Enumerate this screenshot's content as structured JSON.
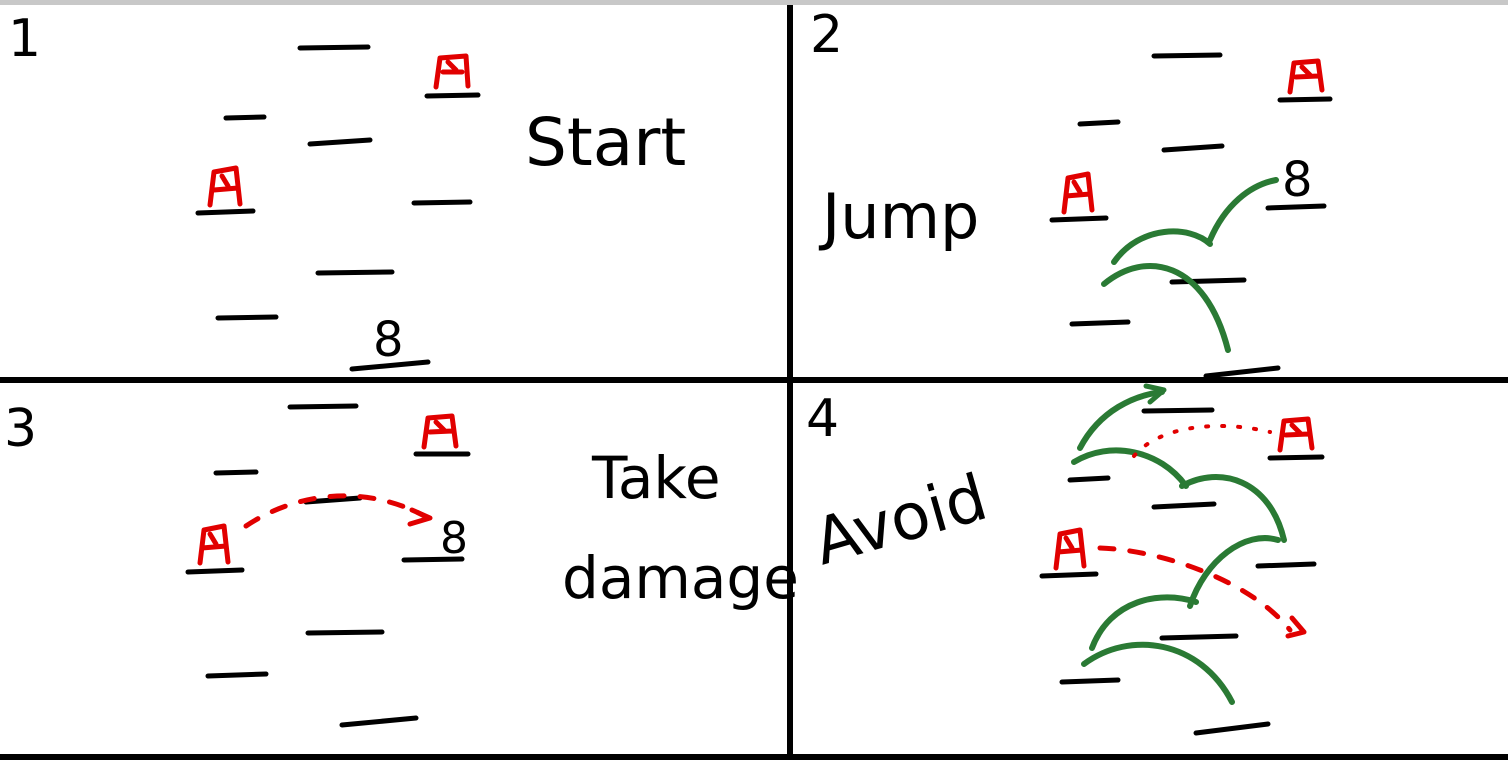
{
  "panels": [
    {
      "number": "1",
      "label": "Start",
      "player_glyph": "8",
      "enemy_glyph": "A"
    },
    {
      "number": "2",
      "label": "Jump",
      "player_glyph": "8",
      "enemy_glyph": "A"
    },
    {
      "number": "3",
      "label": "Take\ndamage",
      "label_lines": [
        "Take",
        "damage"
      ],
      "player_glyph": "8",
      "enemy_glyph": "A"
    },
    {
      "number": "4",
      "label": "Avoid",
      "player_glyph": "",
      "enemy_glyph": "A"
    }
  ],
  "colors": {
    "ink": "#000000",
    "enemy": "#e10000",
    "jump_arc": "#2a7a34",
    "top_bar": "#c8c8c8",
    "background": "#ffffff"
  }
}
